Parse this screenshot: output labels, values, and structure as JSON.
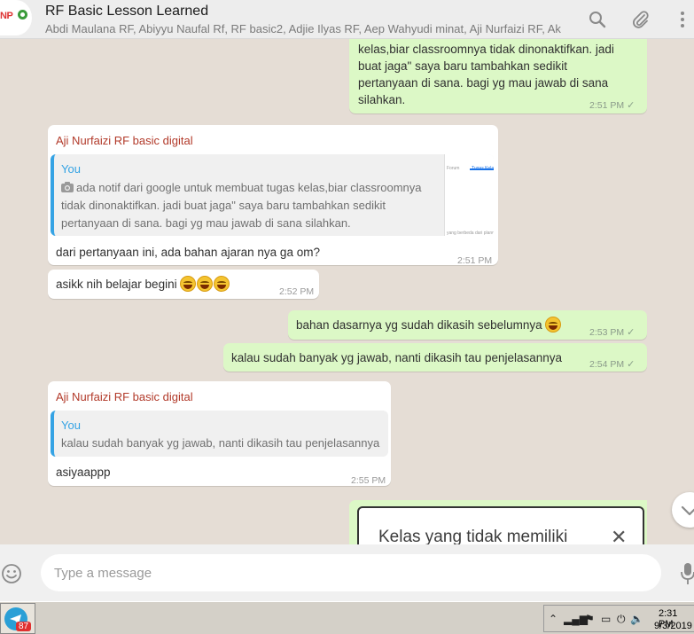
{
  "header": {
    "avatar_text": "NP",
    "avatar_sub": "NURFAIZI PRINTING",
    "title": "RF Basic Lesson Learned",
    "members": "Abdi Maulana RF, Abiyyu Naufal Rf, RF basic2, Adjie Ilyas RF, Aep Wahyudi minat, Aji Nurfaizi RF, Ak...",
    "icons": [
      "search-icon",
      "attach-icon",
      "menu-icon"
    ]
  },
  "messages": {
    "m1": {
      "lines": [
        "kelas,biar classroomnya tidak dinonaktifkan. jadi",
        "buat jaga\" saya baru tambahkan sedikit",
        "pertanyaan di sana. bagi yg mau jawab di sana",
        "silahkan."
      ],
      "time": "2:51 PM"
    },
    "m2": {
      "sender": "Aji Nurfaizi RF basic digital",
      "quote_author": "You",
      "quote_lines": [
        "ada notif dari google untuk membuat tugas kelas,biar classroomnya",
        "tidak dinonaktifkan. jadi buat jaga\" saya baru tambahkan sedikit",
        "pertanyaan di sana. bagi yg mau jawab di sana silahkan."
      ],
      "thumb_tab1": "Forum",
      "thumb_tab2": "Tugas Kelas",
      "thumb_caption": "yang berbeda dari planning ...",
      "text": "dari pertanyaan ini, ada bahan ajaran nya ga om?",
      "time": "2:51 PM"
    },
    "m3": {
      "text": "asikk nih belajar begini",
      "time": "2:52 PM"
    },
    "m4": {
      "text": "bahan dasarnya yg sudah dikasih sebelumnya",
      "time": "2:53 PM"
    },
    "m5": {
      "text": "kalau sudah banyak yg jawab, nanti dikasih tau penjelasannya",
      "time": "2:54 PM"
    },
    "m6": {
      "sender": "Aji Nurfaizi RF basic digital",
      "quote_author": "You",
      "quote_text": "kalau sudah banyak yg jawab, nanti dikasih tau penjelasannya",
      "text": "asiyaappp",
      "time": "2:55 PM"
    },
    "card": {
      "title": "Kelas yang tidak memiliki"
    }
  },
  "composer": {
    "placeholder": "Type a message"
  },
  "taskbar": {
    "app_badge": "87",
    "clock_time": "2:31 PM",
    "clock_date": "9/3/2019"
  },
  "colors": {
    "outgoing": "#dcf8c6",
    "incoming": "#ffffff",
    "background": "#e5ddd5",
    "quote_accent": "#35a3e4",
    "sender_name": "#b23a2a"
  }
}
